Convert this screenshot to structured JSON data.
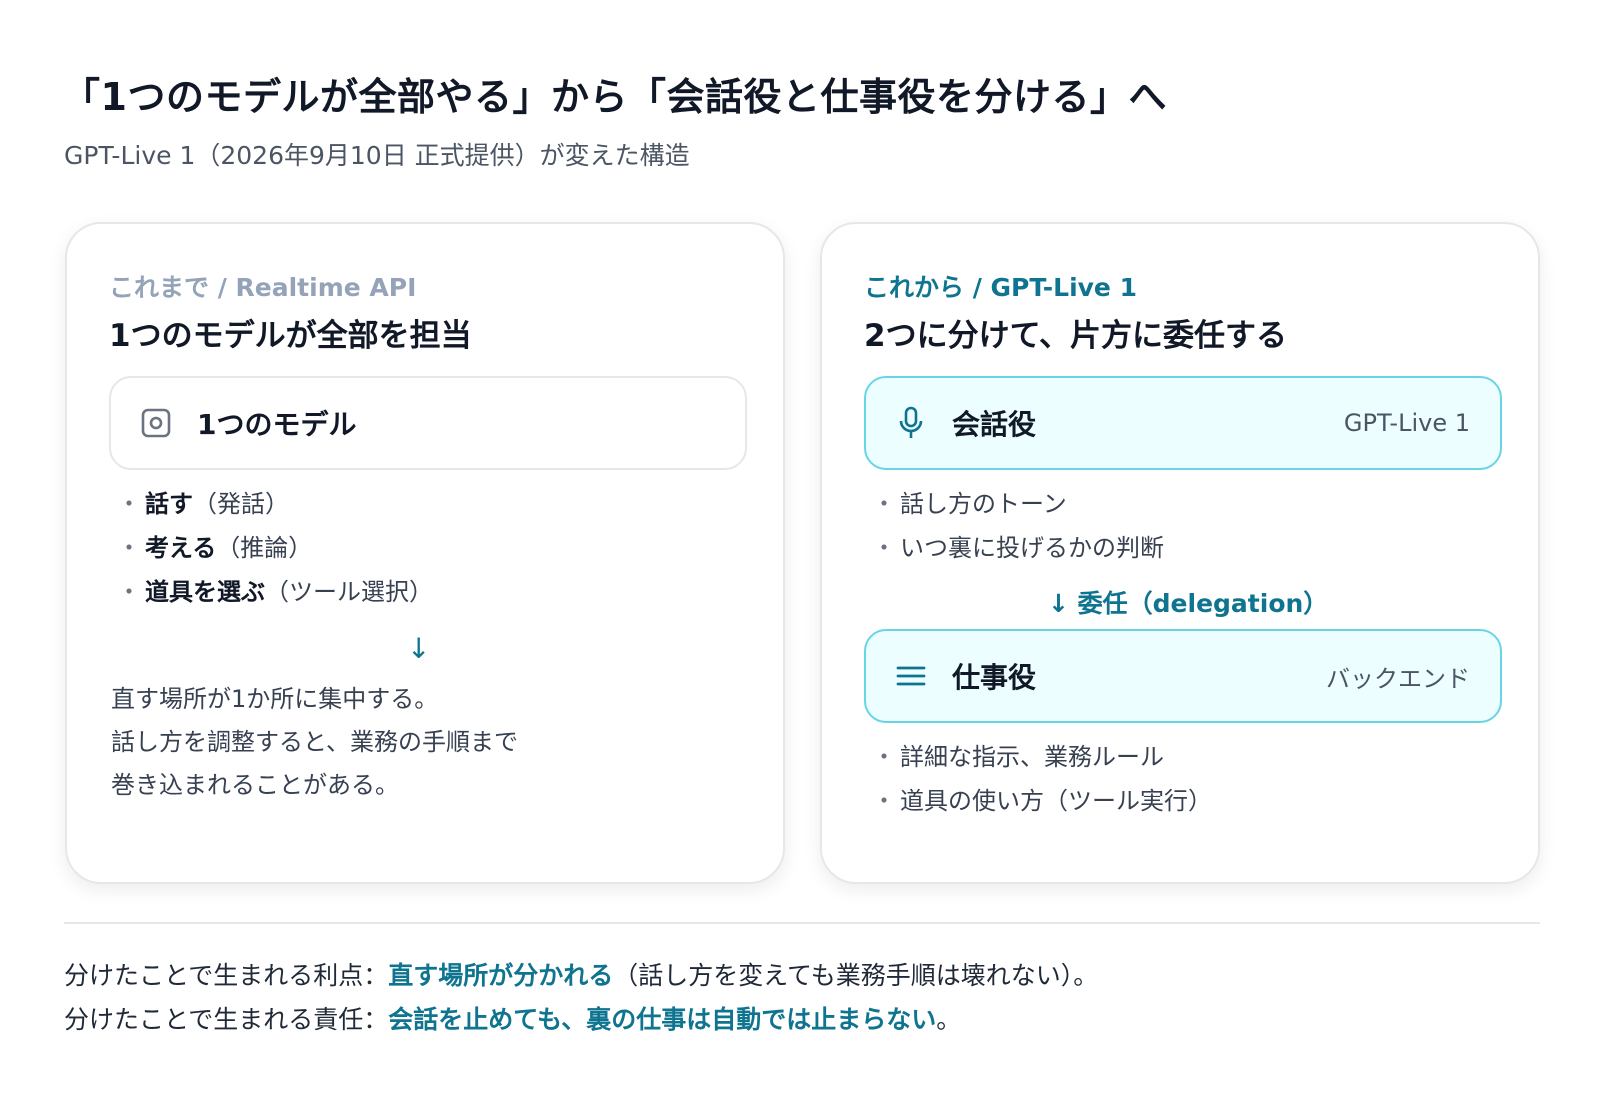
{
  "header": {
    "title": "「1つのモデルが全部やる」から「会話役と仕事役を分ける」へ",
    "subtitle": "GPT-Live 1（2026年9月10日 正式提供）が変えた構造"
  },
  "left_card": {
    "eyebrow": "これまで / Realtime API",
    "title": "1つのモデルが全部を担当",
    "box_label": "1つのモデル",
    "box_icon": "chip-icon",
    "bullets": [
      {
        "strong": "話す",
        "note": "（発話）"
      },
      {
        "strong": "考える",
        "note": "（推論）"
      },
      {
        "strong": "道具を選ぶ",
        "note": "（ツール選択）"
      }
    ],
    "arrow": "↓",
    "note_lines": [
      "直す場所が1か所に集中する。",
      "話し方を調整すると、業務の手順まで",
      "巻き込まれることがある。"
    ]
  },
  "right_card": {
    "eyebrow": "これから / GPT-Live 1",
    "title": "2つに分けて、片方に委任する",
    "box1": {
      "label": "会話役",
      "tag": "GPT-Live 1",
      "icon": "microphone-icon"
    },
    "box1_bullets": [
      "話し方のトーン",
      "いつ裏に投げるかの判断"
    ],
    "delegation": "↓ 委任（delegation）",
    "box2": {
      "label": "仕事役",
      "tag": "バックエンド",
      "icon": "lines-icon"
    },
    "box2_bullets": [
      "詳細な指示、業務ルール",
      "道具の使い方（ツール実行）"
    ]
  },
  "footer": {
    "line1_prefix": "分けたことで生まれる利点：",
    "line1_highlight": "直す場所が分かれる",
    "line1_suffix": "（話し方を変えても業務手順は壊れない）。",
    "line2_prefix": "分けたことで生まれる責任：",
    "line2_highlight": "会話を止めても、裏の仕事は自動では止まらない",
    "line2_suffix": "。"
  },
  "colors": {
    "accent": "#0e7490",
    "cyan_border": "#67d5e4",
    "cyan_fill": "#ecfeff",
    "muted": "#94a3b8"
  }
}
